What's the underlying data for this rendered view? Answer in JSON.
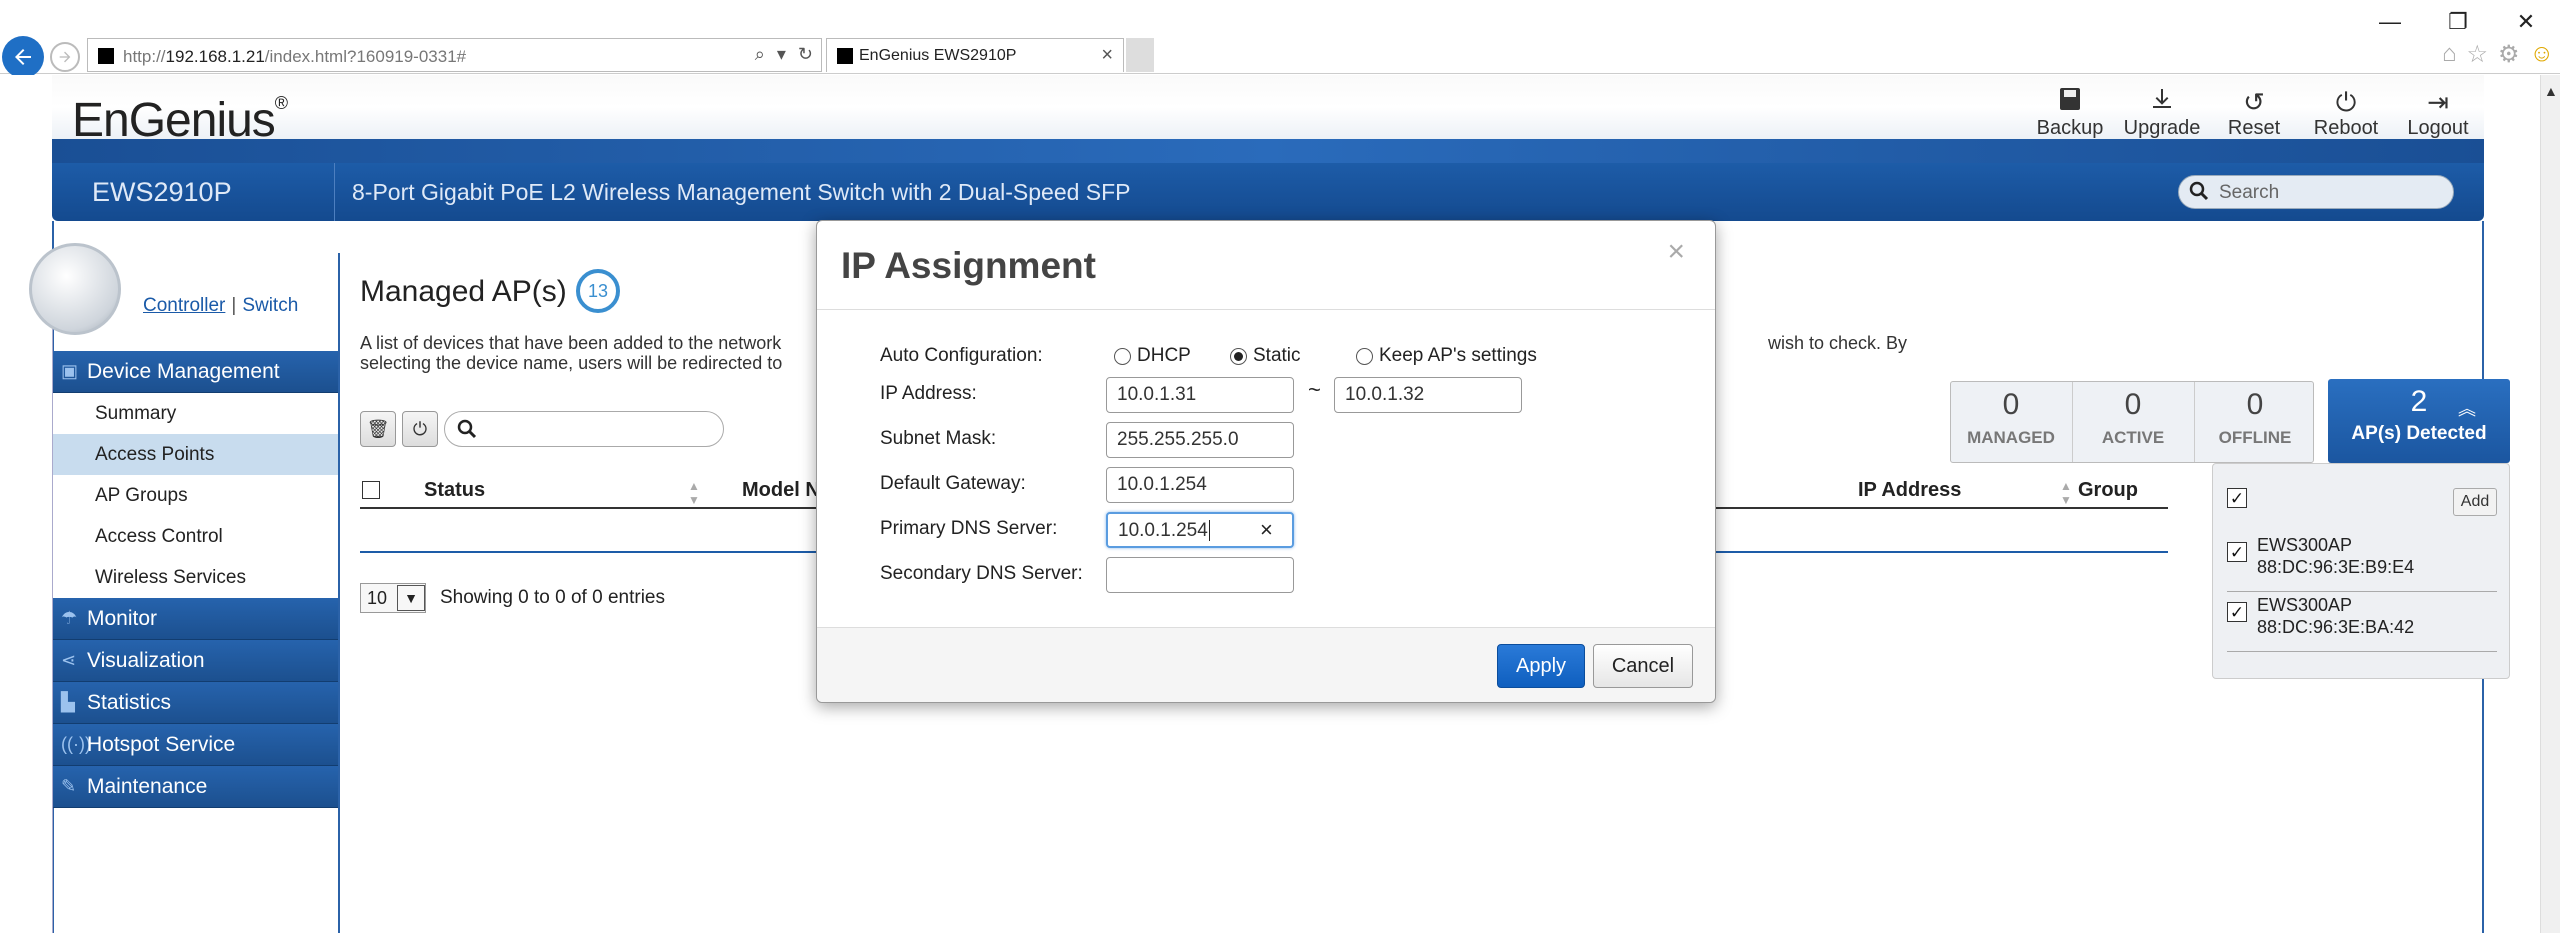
{
  "browser": {
    "url_prefix": "http://",
    "url_host": "192.168.1.21",
    "url_path": "/index.html?160919-0331#",
    "tab_title": "EnGenius EWS2910P",
    "tab_close": "×",
    "window_min": "—",
    "window_restore": "❐",
    "window_close": "✕"
  },
  "header": {
    "logo": "EnGenius",
    "logo_reg": "®",
    "model": "EWS2910P",
    "description": "8-Port Gigabit PoE L2 Wireless Management Switch with 2 Dual-Speed SFP",
    "search_placeholder": "Search",
    "actions": [
      {
        "label": "Backup",
        "icon": "save-icon"
      },
      {
        "label": "Upgrade",
        "icon": "download-icon"
      },
      {
        "label": "Reset",
        "icon": "reset-icon"
      },
      {
        "label": "Reboot",
        "icon": "power-icon"
      },
      {
        "label": "Logout",
        "icon": "logout-icon"
      }
    ]
  },
  "sidebar": {
    "mode_controller": "Controller",
    "mode_sep": "|",
    "mode_switch": "Switch",
    "sections": [
      {
        "label": "Device Management",
        "icon": "device-icon"
      },
      {
        "label": "Monitor",
        "icon": "monitor-icon"
      },
      {
        "label": "Visualization",
        "icon": "share-icon"
      },
      {
        "label": "Statistics",
        "icon": "chart-icon"
      },
      {
        "label": "Hotspot Service",
        "icon": "wifi-icon"
      },
      {
        "label": "Maintenance",
        "icon": "wrench-icon"
      }
    ],
    "items": [
      {
        "label": "Summary"
      },
      {
        "label": "Access Points"
      },
      {
        "label": "AP Groups"
      },
      {
        "label": "Access Control"
      },
      {
        "label": "Wireless Services"
      }
    ]
  },
  "main": {
    "title": "Managed AP(s)",
    "count": "13",
    "desc_line1": "A list of devices that have been added to the network",
    "desc_line1_right": "wish to check. By",
    "desc_line2": "selecting the device name, users will be redirected to",
    "columns": {
      "status": "Status",
      "model": "Model N",
      "ip": "IP Address",
      "group": "Group"
    },
    "page_size": "10",
    "showing": "Showing 0 to 0 of 0 entries"
  },
  "stats": {
    "managed": {
      "num": "0",
      "label": "MANAGED"
    },
    "active": {
      "num": "0",
      "label": "ACTIVE"
    },
    "offline": {
      "num": "0",
      "label": "OFFLINE"
    },
    "detected": {
      "num": "2",
      "label": "AP(s) Detected"
    }
  },
  "detected_list": {
    "add_label": "Add",
    "items": [
      {
        "name": "EWS300AP",
        "mac": "88:DC:96:3E:B9:E4"
      },
      {
        "name": "EWS300AP",
        "mac": "88:DC:96:3E:BA:42"
      }
    ]
  },
  "modal": {
    "title": "IP Assignment",
    "close": "×",
    "auto_config_label": "Auto Configuration:",
    "options": {
      "dhcp": "DHCP",
      "static": "Static",
      "keep": "Keep AP's settings"
    },
    "selected": "static",
    "ip_label": "IP Address:",
    "ip_start": "10.0.1.31",
    "ip_tilde": "~",
    "ip_end": "10.0.1.32",
    "subnet_label": "Subnet Mask:",
    "subnet": "255.255.255.0",
    "gateway_label": "Default Gateway:",
    "gateway": "10.0.1.254",
    "dns1_label": "Primary DNS Server:",
    "dns1": "10.0.1.254",
    "dns2_label": "Secondary DNS Server:",
    "dns2": "",
    "apply": "Apply",
    "cancel": "Cancel"
  },
  "colors": {
    "brand_blue": "#1d5ca8",
    "apply_blue": "#1a6dcc",
    "active_item": "#c8dcee"
  }
}
